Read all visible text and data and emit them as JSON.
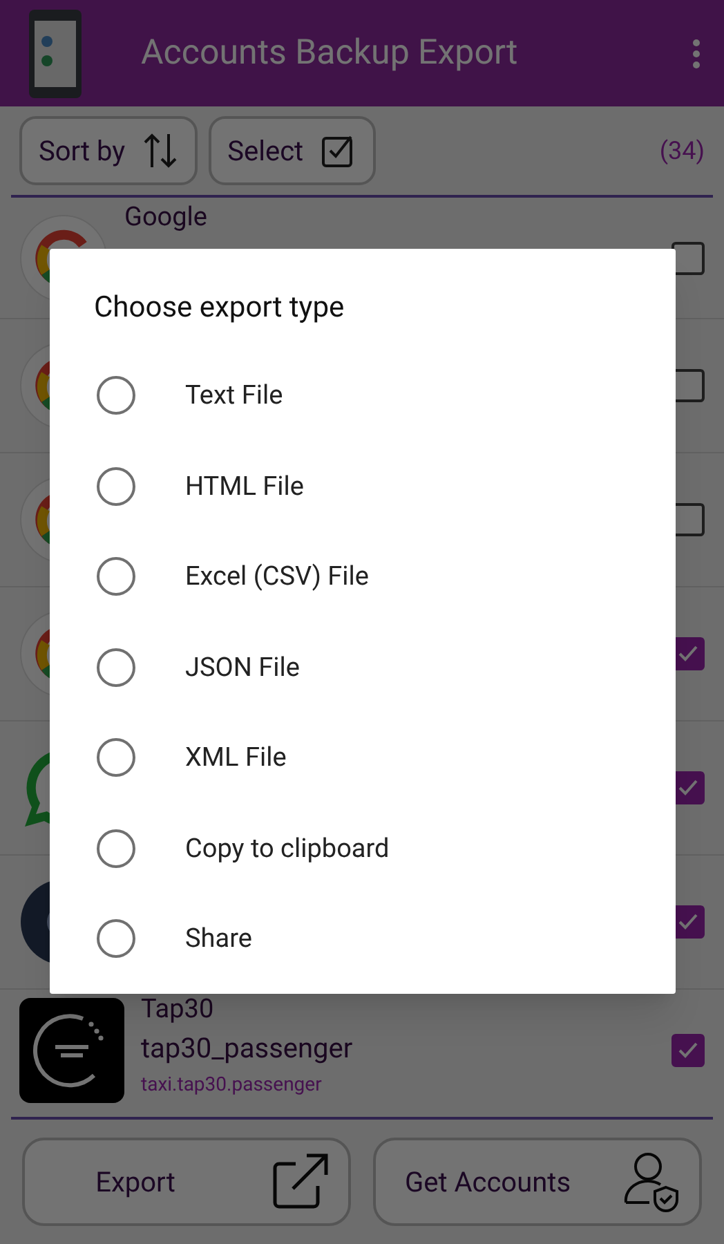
{
  "app_bar": {
    "title": "Accounts Backup Export"
  },
  "toolbar": {
    "sort_button": "Sort by",
    "select_button": "Select",
    "count": "(34)"
  },
  "accounts": [
    {
      "kind": "google",
      "name": "Google",
      "checked": false
    },
    {
      "kind": "google",
      "checked": false
    },
    {
      "kind": "google",
      "checked": false
    },
    {
      "kind": "google",
      "checked": true
    },
    {
      "kind": "chat",
      "checked": true
    },
    {
      "kind": "dark",
      "checked": true
    },
    {
      "kind": "tap",
      "name": "Tap30",
      "account": "tap30_passenger",
      "package": "taxi.tap30.passenger",
      "checked": true
    }
  ],
  "bottom_buttons": [
    {
      "label": "Export",
      "kind": "export"
    },
    {
      "label": "Get Accounts",
      "kind": "accounts"
    }
  ],
  "dialog": {
    "title": "Choose export type",
    "options": [
      {
        "label": "Text File",
        "selected": false
      },
      {
        "label": "HTML File",
        "selected": false
      },
      {
        "label": "Excel (CSV) File",
        "selected": false
      },
      {
        "label": "JSON File",
        "selected": false
      },
      {
        "label": "XML File",
        "selected": false
      },
      {
        "label": "Copy to clipboard",
        "selected": false
      },
      {
        "label": "Share",
        "selected": false
      }
    ]
  }
}
